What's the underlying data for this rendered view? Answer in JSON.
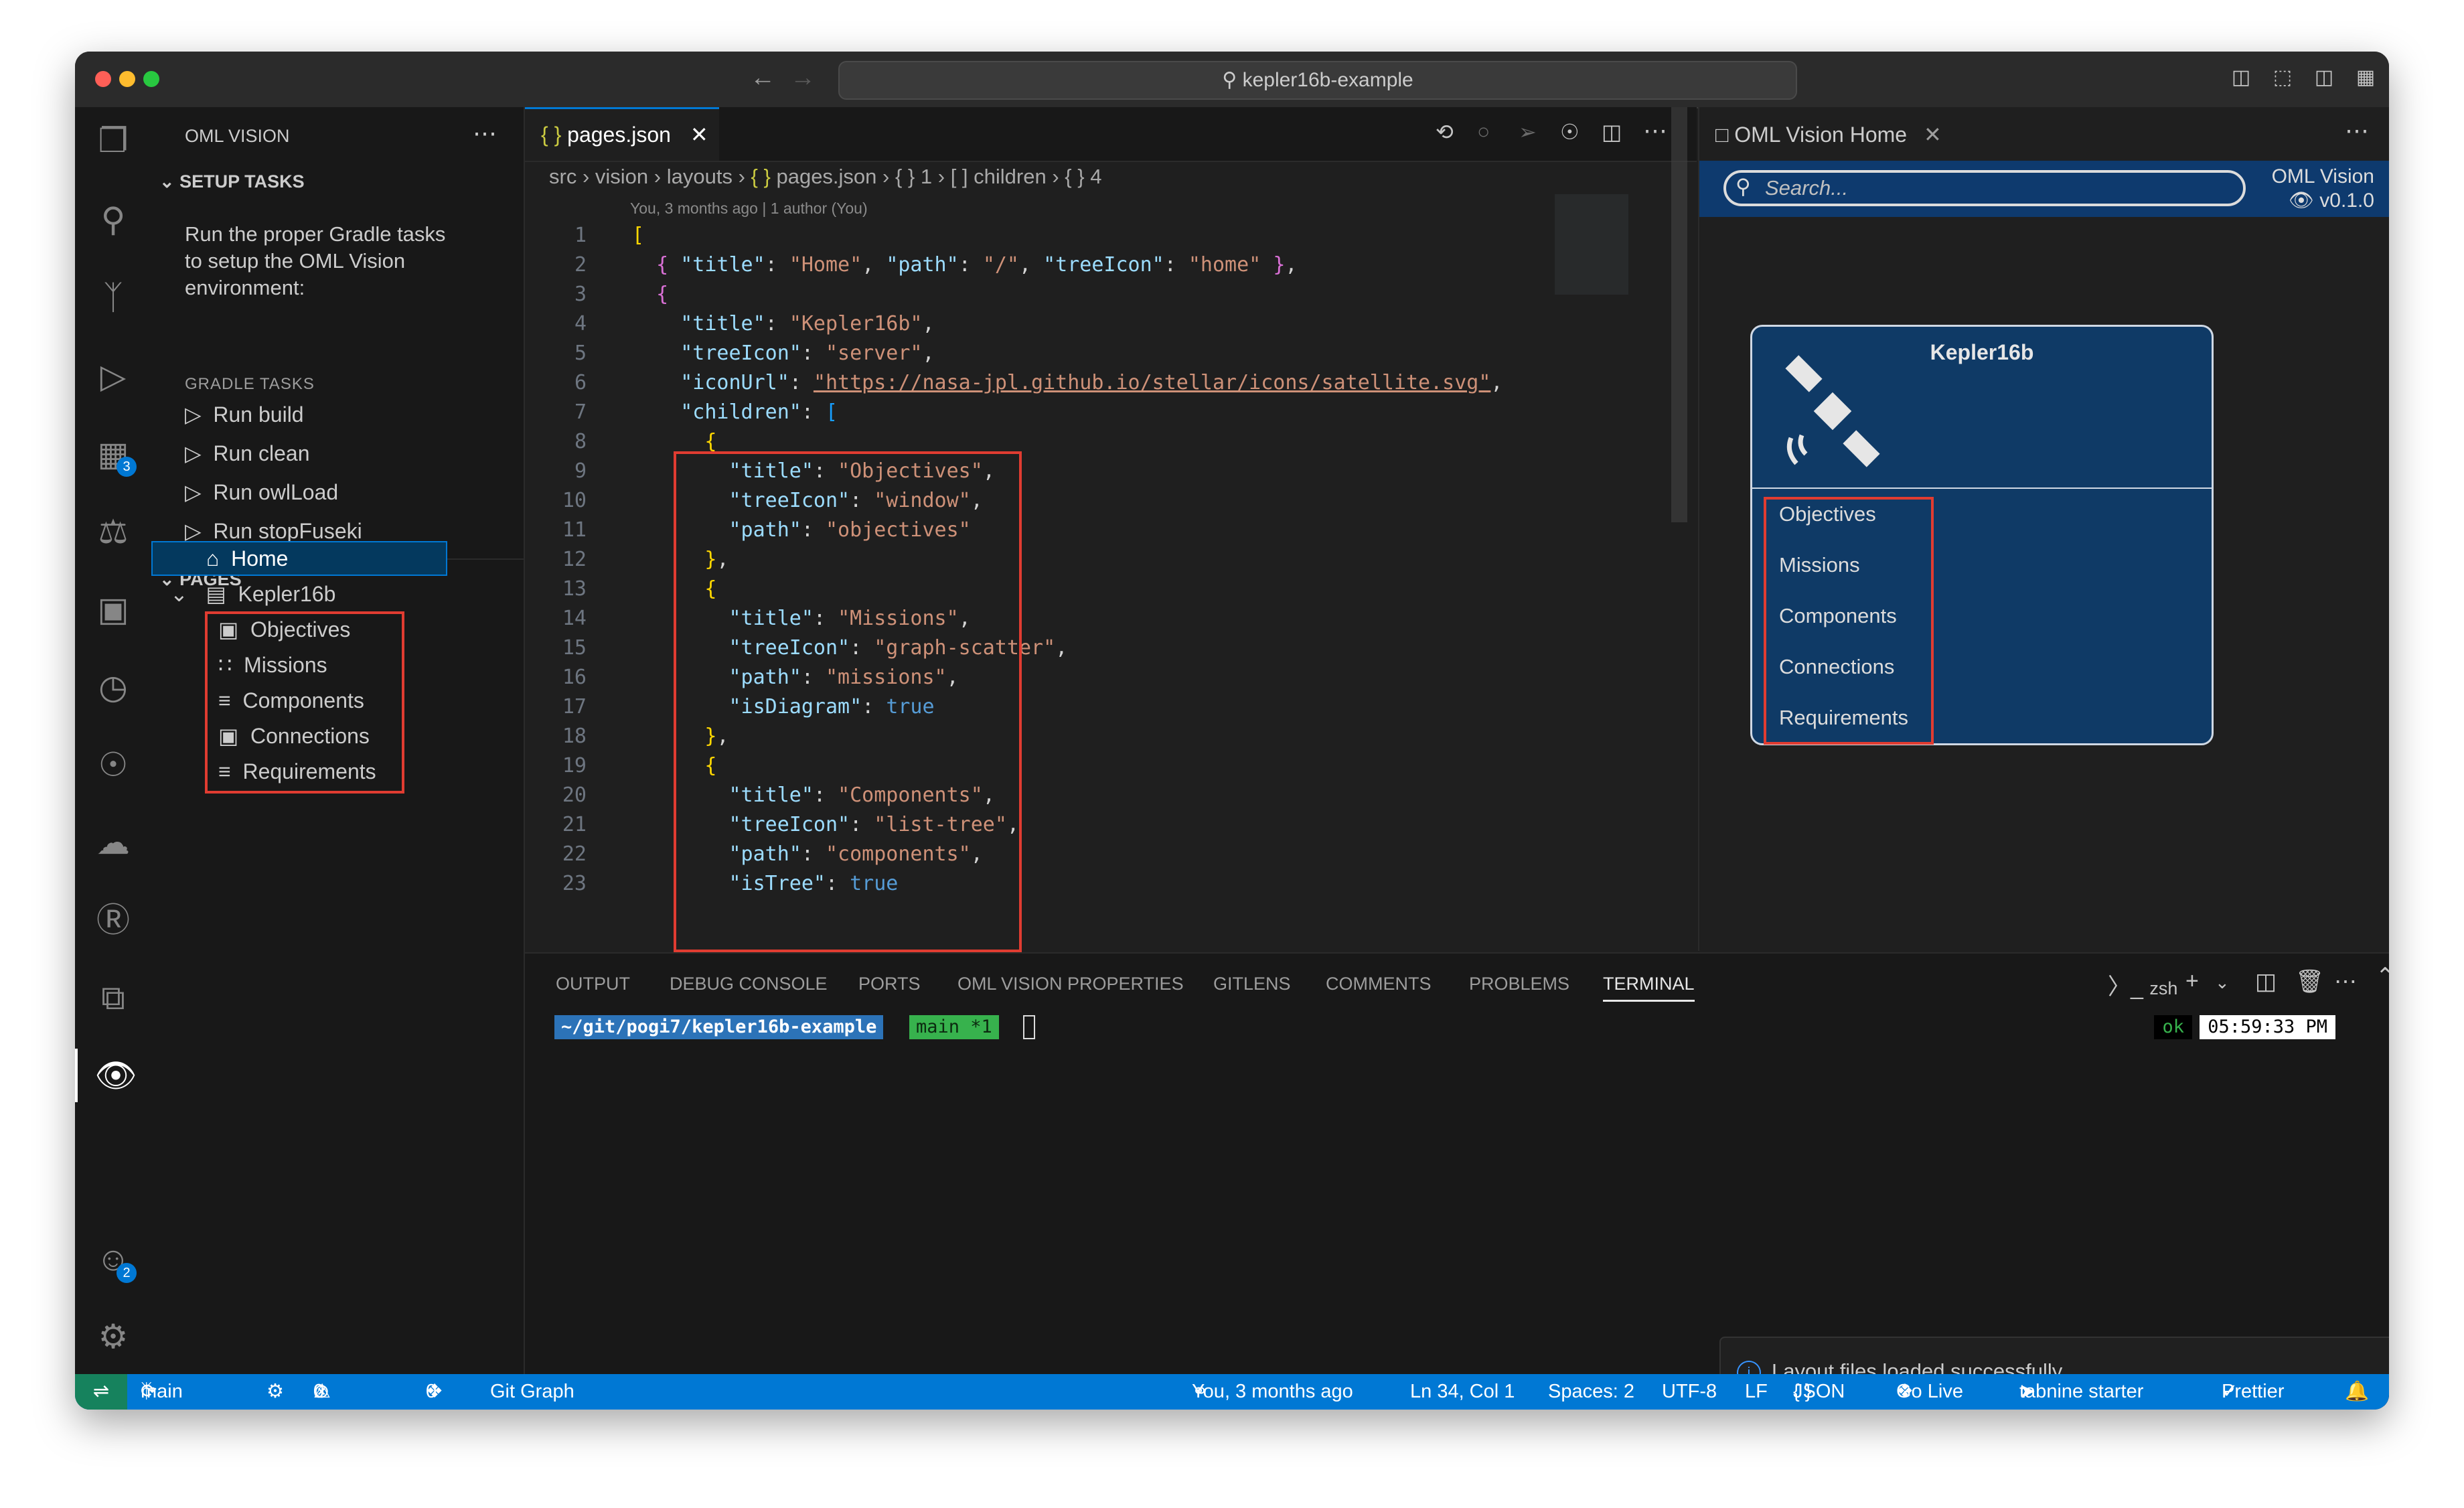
{
  "titlebar": {
    "search_text": "kepler16b-example"
  },
  "activity": {
    "extensions_badge": "3",
    "accounts_badge": "2"
  },
  "sidebar": {
    "title": "OML VISION",
    "setup_title": "SETUP TASKS",
    "setup_desc": "Run the proper Gradle tasks to setup the OML Vision environment:",
    "gradle_title": "GRADLE TASKS",
    "tasks": [
      "Run build",
      "Run clean",
      "Run owlLoad",
      "Run stopFuseki"
    ],
    "pages_title": "PAGES",
    "pages": {
      "home": "Home",
      "kepler": "Kepler16b",
      "children": [
        "Objectives",
        "Missions",
        "Components",
        "Connections",
        "Requirements"
      ]
    }
  },
  "editor": {
    "tab": "pages.json",
    "breadcrumb": [
      "src",
      "vision",
      "layouts",
      "pages.json",
      "1",
      "children",
      "4"
    ],
    "blame": "You, 3 months ago | 1 author (You)",
    "line_numbers": [
      "1",
      "2",
      "3",
      "4",
      "5",
      "6",
      "7",
      "8",
      "9",
      "10",
      "11",
      "12",
      "13",
      "14",
      "15",
      "16",
      "17",
      "18",
      "19",
      "20",
      "21",
      "22",
      "23"
    ],
    "code": {
      "l1": "[",
      "l2_title": "\"Home\"",
      "l2_path": "\"/\"",
      "l2_icon": "\"home\"",
      "l4_title": "\"Kepler16b\"",
      "l5_icon": "\"server\"",
      "l6_url": "\"https://nasa-jpl.github.io/stellar/icons/satellite.svg\"",
      "l9": "\"Objectives\"",
      "l10": "\"window\"",
      "l11": "\"objectives\"",
      "l14": "\"Missions\"",
      "l15": "\"graph-scatter\"",
      "l16": "\"missions\"",
      "l17": "true",
      "l20": "\"Components\"",
      "l21": "\"list-tree\"",
      "l22": "\"components\"",
      "l23": "true"
    }
  },
  "preview": {
    "tab": "OML Vision Home",
    "search_placeholder": "Search...",
    "brand": "OML Vision",
    "version": "v0.1.0",
    "card_title": "Kepler16b",
    "card_items": [
      "Objectives",
      "Missions",
      "Components",
      "Connections",
      "Requirements"
    ]
  },
  "panel": {
    "tabs": [
      "OUTPUT",
      "DEBUG CONSOLE",
      "PORTS",
      "OML VISION PROPERTIES",
      "GITLENS",
      "COMMENTS",
      "PROBLEMS",
      "TERMINAL"
    ],
    "shell": "zsh",
    "prompt_path": "~/git/pogi7/kepler16b-example",
    "prompt_branch": "main *1",
    "ok": "ok",
    "time": "05:59:33 PM",
    "toast": "Layout files loaded successfully."
  },
  "status": {
    "branch": "main",
    "errors": "0",
    "warnings": "0",
    "ports": "0",
    "git_graph": "Git Graph",
    "blame": "You, 3 months ago",
    "position": "Ln 34, Col 1",
    "spaces": "Spaces: 2",
    "encoding": "UTF-8",
    "eol": "LF",
    "language": "JSON",
    "golive": "Go Live",
    "tabnine": "tabnine starter",
    "prettier": "Prettier"
  }
}
